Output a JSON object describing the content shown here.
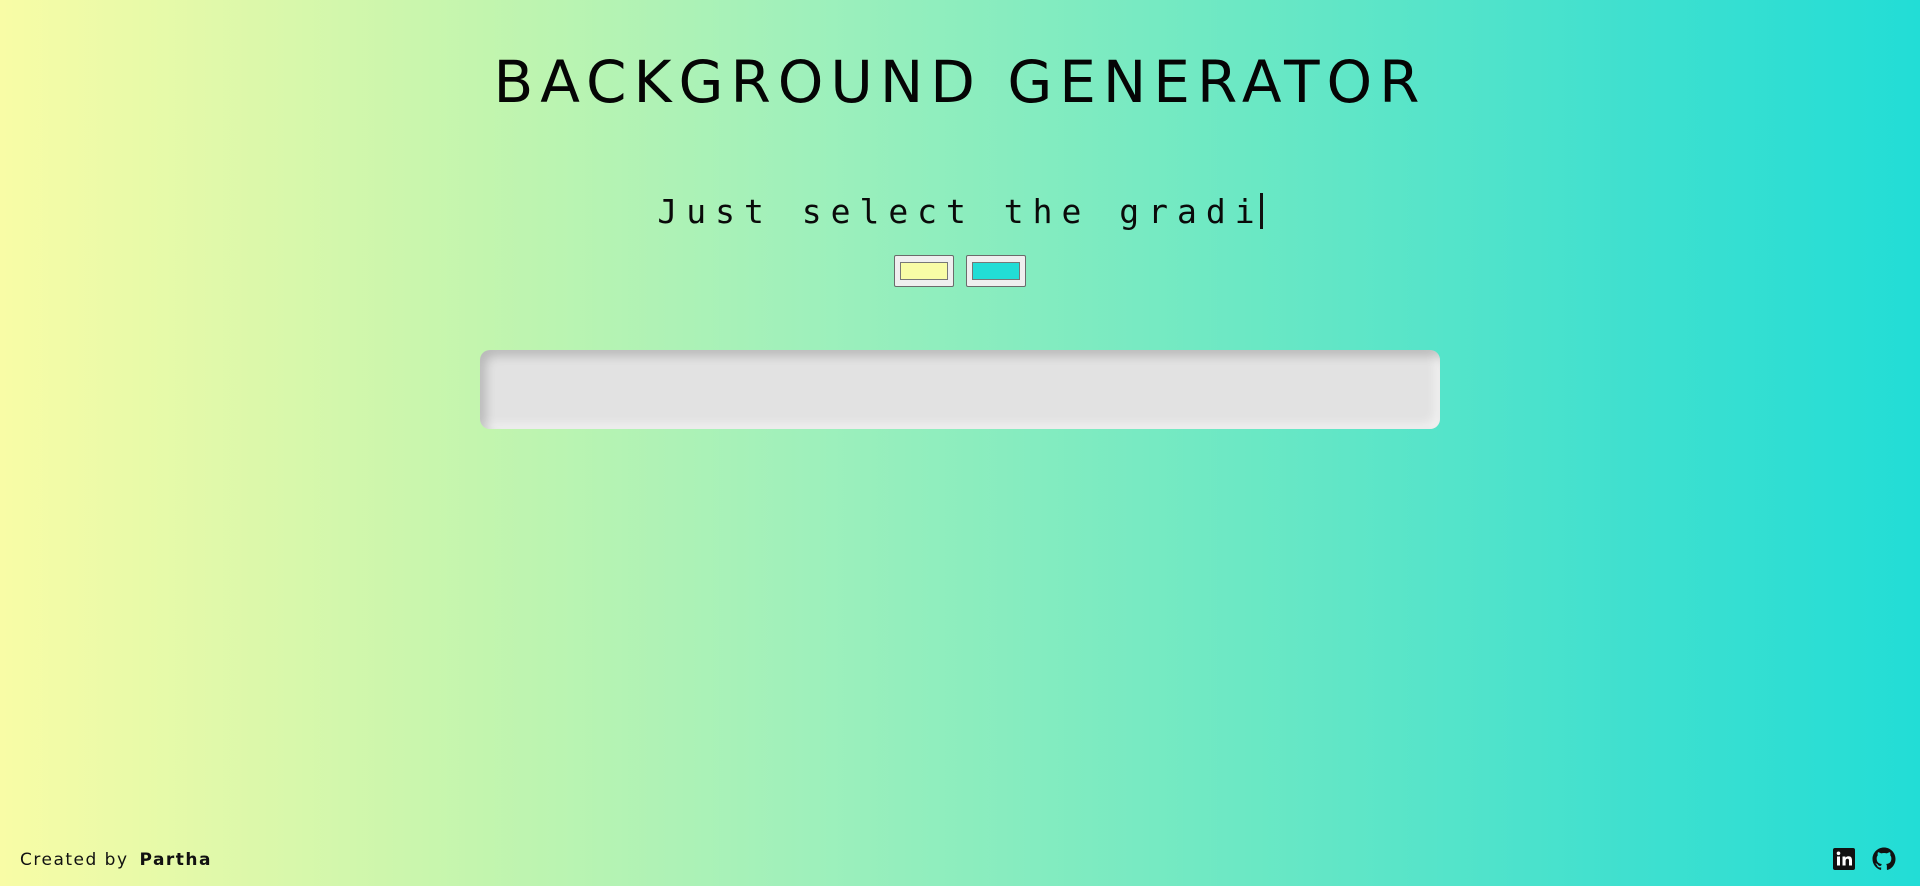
{
  "header": {
    "title": "BACKGROUND GENERATOR"
  },
  "typing": {
    "text": "Just select the gradi"
  },
  "color_pickers": [
    {
      "name": "color-1",
      "value": "#f8fca6"
    },
    {
      "name": "color-2",
      "value": "#22ddd6"
    }
  ],
  "output": {
    "css_text": ""
  },
  "footer": {
    "created_by_label": "Created by",
    "author": "Partha"
  },
  "social": [
    {
      "icon": "linkedin-icon"
    },
    {
      "icon": "github-icon"
    }
  ],
  "colors": {
    "gradient_start": "#f8fca6",
    "gradient_end": "#22ddd6",
    "output_box": "#e2e2e2"
  }
}
